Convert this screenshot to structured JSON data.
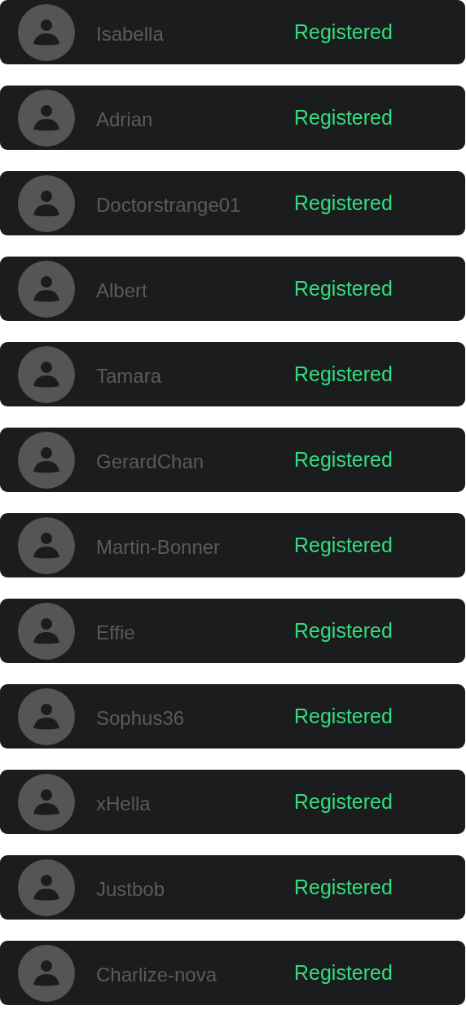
{
  "users": [
    {
      "name": "Isabella",
      "status": "Registered"
    },
    {
      "name": "Adrian",
      "status": "Registered"
    },
    {
      "name": "Doctorstrange01",
      "status": "Registered"
    },
    {
      "name": "Albert",
      "status": "Registered"
    },
    {
      "name": "Tamara",
      "status": "Registered"
    },
    {
      "name": "GerardChan",
      "status": "Registered"
    },
    {
      "name": "Martin-Bonner",
      "status": "Registered"
    },
    {
      "name": "Effie",
      "status": "Registered"
    },
    {
      "name": "Sophus36",
      "status": "Registered"
    },
    {
      "name": "xHella",
      "status": "Registered"
    },
    {
      "name": "Justbob",
      "status": "Registered"
    },
    {
      "name": "Charlize-nova",
      "status": "Registered"
    }
  ]
}
